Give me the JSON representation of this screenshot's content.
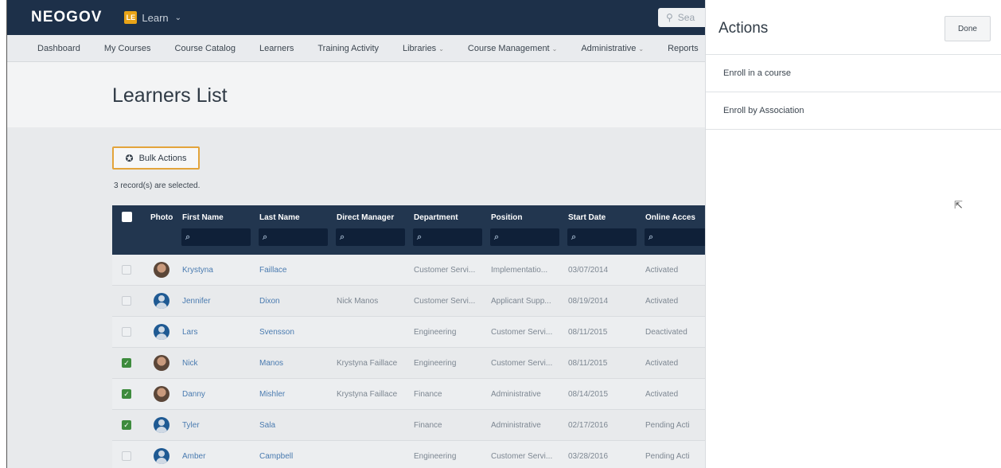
{
  "topbar": {
    "logo": "NEOGOV",
    "app_badge": "LE",
    "app_name": "Learn",
    "search_placeholder": "Sea"
  },
  "nav": {
    "items": [
      {
        "label": "Dashboard",
        "dropdown": false
      },
      {
        "label": "My Courses",
        "dropdown": false
      },
      {
        "label": "Course Catalog",
        "dropdown": false
      },
      {
        "label": "Learners",
        "dropdown": false
      },
      {
        "label": "Training Activity",
        "dropdown": false
      },
      {
        "label": "Libraries",
        "dropdown": true
      },
      {
        "label": "Course Management",
        "dropdown": true
      },
      {
        "label": "Administrative",
        "dropdown": true
      },
      {
        "label": "Reports",
        "dropdown": false
      }
    ]
  },
  "page": {
    "title": "Learners List",
    "bulk_actions_label": "Bulk Actions",
    "selection_text": "3 record(s) are selected."
  },
  "table": {
    "columns": [
      "Photo",
      "First Name",
      "Last Name",
      "Direct Manager",
      "Department",
      "Position",
      "Start Date",
      "Online Acces"
    ],
    "rows": [
      {
        "checked": false,
        "avatar": "photo",
        "first": "Krystyna",
        "last": "Faillace",
        "manager": "",
        "department": "Customer Servi...",
        "position": "Implementatio...",
        "start": "03/07/2014",
        "access": "Activated"
      },
      {
        "checked": false,
        "avatar": "generic",
        "first": "Jennifer",
        "last": "Dixon",
        "manager": "Nick Manos",
        "department": "Customer Servi...",
        "position": "Applicant Supp...",
        "start": "08/19/2014",
        "access": "Activated"
      },
      {
        "checked": false,
        "avatar": "generic",
        "first": "Lars",
        "last": "Svensson",
        "manager": "",
        "department": "Engineering",
        "position": "Customer Servi...",
        "start": "08/11/2015",
        "access": "Deactivated"
      },
      {
        "checked": true,
        "avatar": "photo",
        "first": "Nick",
        "last": "Manos",
        "manager": "Krystyna Faillace",
        "department": "Engineering",
        "position": "Customer Servi...",
        "start": "08/11/2015",
        "access": "Activated"
      },
      {
        "checked": true,
        "avatar": "photo",
        "first": "Danny",
        "last": "Mishler",
        "manager": "Krystyna Faillace",
        "department": "Finance",
        "position": "Administrative",
        "start": "08/14/2015",
        "access": "Activated"
      },
      {
        "checked": true,
        "avatar": "generic",
        "first": "Tyler",
        "last": "Sala",
        "manager": "",
        "department": "Finance",
        "position": "Administrative",
        "start": "02/17/2016",
        "access": "Pending Acti"
      },
      {
        "checked": false,
        "avatar": "generic",
        "first": "Amber",
        "last": "Campbell",
        "manager": "",
        "department": "Engineering",
        "position": "Customer Servi...",
        "start": "03/28/2016",
        "access": "Pending Acti"
      }
    ]
  },
  "panel": {
    "title": "Actions",
    "done_label": "Done",
    "items": [
      "Enroll in a course",
      "Enroll by Association"
    ]
  }
}
